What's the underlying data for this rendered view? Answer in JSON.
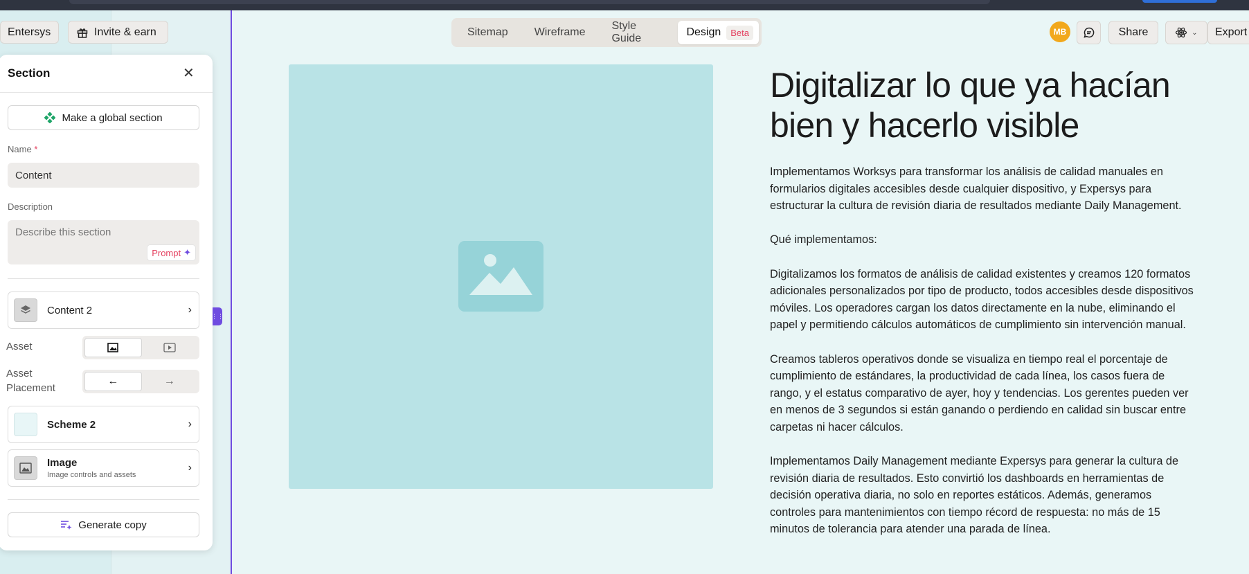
{
  "topbar": {
    "workspace_label": "Entersys",
    "invite_label": "Invite & earn",
    "tabs": [
      {
        "label": "Sitemap"
      },
      {
        "label": "Wireframe"
      },
      {
        "label": "Style Guide"
      },
      {
        "label": "Design",
        "badge": "Beta",
        "active": true
      }
    ],
    "avatar_initials": "MB",
    "share_label": "Share",
    "export_label": "Export"
  },
  "panel": {
    "title": "Section",
    "global_section_label": "Make a global section",
    "name_label": "Name",
    "name_required_mark": "*",
    "name_value": "Content",
    "description_label": "Description",
    "description_placeholder": "Describe this section",
    "prompt_label": "Prompt",
    "layout_label": "Content 2",
    "asset_label": "Asset",
    "asset_placement_label": "Asset\nPlacement",
    "scheme_label": "Scheme 2",
    "image_title": "Image",
    "image_subtitle": "Image controls and assets",
    "generate_copy_label": "Generate copy"
  },
  "content": {
    "heading": "Digitalizar lo que ya hacían bien y hacerlo visible",
    "body": "Implementamos Worksys para transformar los análisis de calidad manuales en formularios digitales accesibles desde cualquier dispositivo, y Expersys para estructurar la cultura de revisión diaria de resultados mediante Daily Management.\n\nQué implementamos:\n\nDigitalizamos los formatos de análisis de calidad existentes y creamos 120 formatos adicionales personalizados por tipo de producto, todos accesibles desde dispositivos móviles. Los operadores cargan los datos directamente en la nube, eliminando el papel y permitiendo cálculos automáticos de cumplimiento sin intervención manual.\n\nCreamos tableros operativos donde se visualiza en tiempo real el porcentaje de cumplimiento de estándares, la productividad de cada línea, los casos fuera de rango, y el estatus comparativo de ayer, hoy y tendencias. Los gerentes pueden ver en menos de 3 segundos si están ganando o perdiendo en calidad sin buscar entre carpetas ni hacer cálculos.\n\nImplementamos Daily Management mediante Expersys para generar la cultura de revisión diaria de resultados. Esto convirtió los dashboards en herramientas de decisión operativa diaria, no solo en reportes estáticos. Además, generamos controles para mantenimientos con tiempo récord de respuesta: no más de 15 minutos de tolerancia para atender una parada de línea."
  },
  "colors": {
    "accent": "#6f4ce0",
    "canvas_bg": "#e9f6f6",
    "image_placeholder": "#b9e3e6",
    "avatar": "#f2a81c",
    "beta": "#e4405f"
  }
}
